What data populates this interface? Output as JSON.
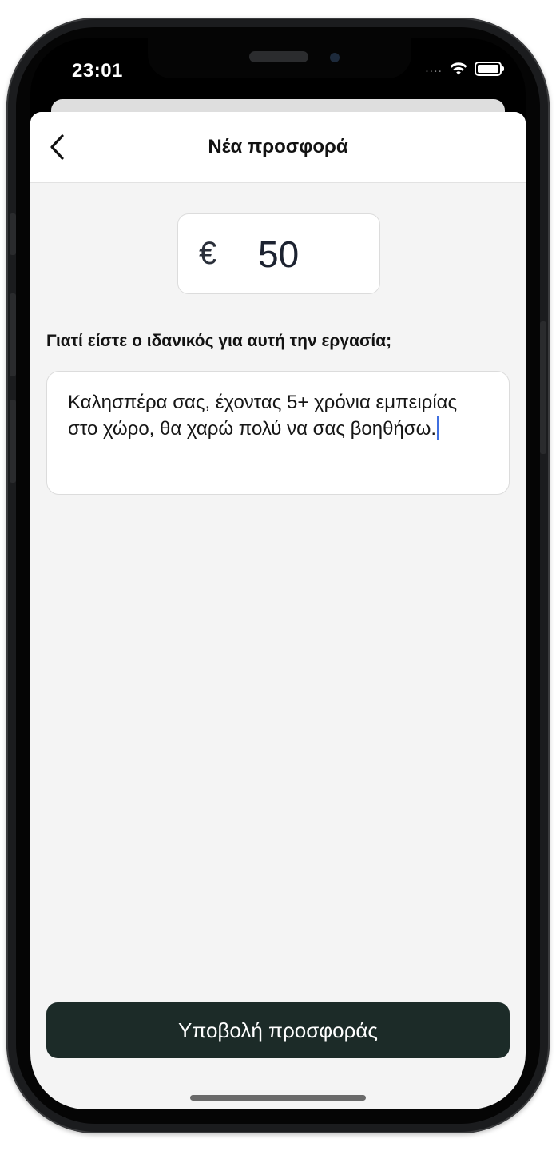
{
  "status_bar": {
    "time": "23:01",
    "signal": "....",
    "wifi_icon": "wifi-icon",
    "battery_icon": "battery-icon"
  },
  "nav": {
    "back_icon": "chevron-left-icon",
    "title": "Νέα προσφορά"
  },
  "offer": {
    "currency_symbol": "€",
    "amount": "50"
  },
  "question": {
    "label": "Γιατί είστε ο ιδανικός για αυτή την εργασία;",
    "value": "Καλησπέρα σας, έχοντας 5+ χρόνια εμπειρίας στο χώρο, θα χαρώ πολύ να σας βοηθήσω."
  },
  "submit": {
    "label": "Υποβολή προσφοράς"
  },
  "colors": {
    "submit_bg": "#1c2b28",
    "sheet_bg": "#f4f4f4",
    "caret": "#3f6fe0"
  }
}
